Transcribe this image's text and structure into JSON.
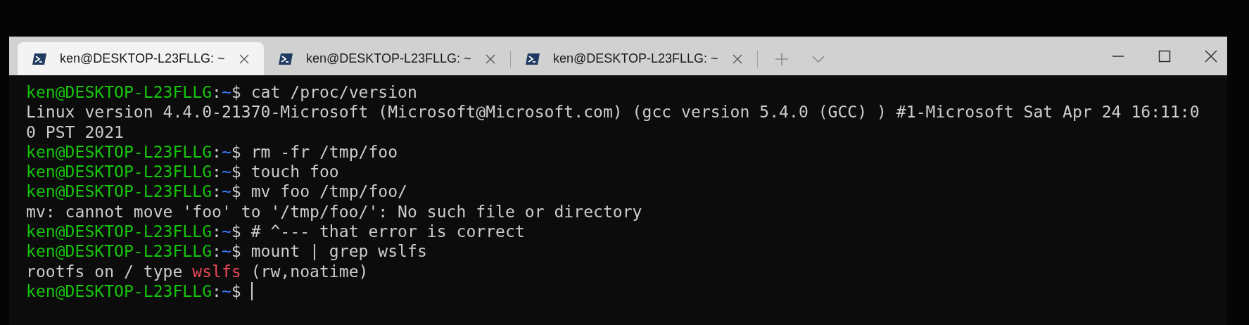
{
  "tabs": [
    {
      "title": "ken@DESKTOP-L23FLLG: ~",
      "selected": true
    },
    {
      "title": "ken@DESKTOP-L23FLLG: ~",
      "selected": false
    },
    {
      "title": "ken@DESKTOP-L23FLLG: ~",
      "selected": false
    }
  ],
  "terminal": {
    "cursor": true,
    "lines": [
      [
        {
          "text": "ken@DESKTOP-L23FLLG",
          "color": "#16c60c"
        },
        {
          "text": ":",
          "color": "#cccccc"
        },
        {
          "text": "~",
          "color": "#3b78ff"
        },
        {
          "text": "$ cat /proc/version",
          "color": "#cccccc"
        }
      ],
      [
        {
          "text": "Linux version 4.4.0-21370-Microsoft (Microsoft@Microsoft.com) (gcc version 5.4.0 (GCC) ) #1-Microsoft Sat Apr 24 16:11:0",
          "color": "#cccccc"
        }
      ],
      [
        {
          "text": "0 PST 2021",
          "color": "#cccccc"
        }
      ],
      [
        {
          "text": "ken@DESKTOP-L23FLLG",
          "color": "#16c60c"
        },
        {
          "text": ":",
          "color": "#cccccc"
        },
        {
          "text": "~",
          "color": "#3b78ff"
        },
        {
          "text": "$ rm -fr /tmp/foo",
          "color": "#cccccc"
        }
      ],
      [
        {
          "text": "ken@DESKTOP-L23FLLG",
          "color": "#16c60c"
        },
        {
          "text": ":",
          "color": "#cccccc"
        },
        {
          "text": "~",
          "color": "#3b78ff"
        },
        {
          "text": "$ touch foo",
          "color": "#cccccc"
        }
      ],
      [
        {
          "text": "ken@DESKTOP-L23FLLG",
          "color": "#16c60c"
        },
        {
          "text": ":",
          "color": "#cccccc"
        },
        {
          "text": "~",
          "color": "#3b78ff"
        },
        {
          "text": "$ mv foo /tmp/foo/",
          "color": "#cccccc"
        }
      ],
      [
        {
          "text": "mv: cannot move 'foo' to '/tmp/foo/': No such file or directory",
          "color": "#cccccc"
        }
      ],
      [
        {
          "text": "ken@DESKTOP-L23FLLG",
          "color": "#16c60c"
        },
        {
          "text": ":",
          "color": "#cccccc"
        },
        {
          "text": "~",
          "color": "#3b78ff"
        },
        {
          "text": "$ # ^--- that error is correct",
          "color": "#cccccc"
        }
      ],
      [
        {
          "text": "ken@DESKTOP-L23FLLG",
          "color": "#16c60c"
        },
        {
          "text": ":",
          "color": "#cccccc"
        },
        {
          "text": "~",
          "color": "#3b78ff"
        },
        {
          "text": "$ mount | grep wslfs",
          "color": "#cccccc"
        }
      ],
      [
        {
          "text": "rootfs on / type ",
          "color": "#cccccc"
        },
        {
          "text": "wslfs",
          "color": "#e74856"
        },
        {
          "text": " (rw,noatime)",
          "color": "#cccccc"
        }
      ],
      [
        {
          "text": "ken@DESKTOP-L23FLLG",
          "color": "#16c60c"
        },
        {
          "text": ":",
          "color": "#cccccc"
        },
        {
          "text": "~",
          "color": "#3b78ff"
        },
        {
          "text": "$ ",
          "color": "#cccccc"
        }
      ]
    ]
  }
}
